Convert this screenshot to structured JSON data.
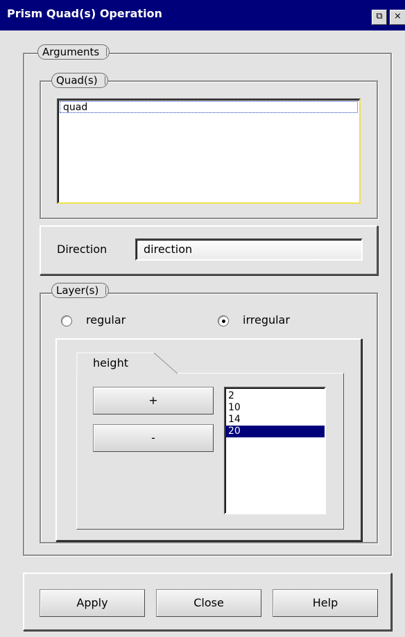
{
  "window": {
    "title": "Prism Quad(s) Operation",
    "restore_icon": "restore-icon",
    "close_icon": "close-icon"
  },
  "arguments": {
    "label": "Arguments",
    "quads": {
      "label": "Quad(s)",
      "items": [
        "quad"
      ]
    },
    "direction": {
      "label": "Direction",
      "value": "direction"
    },
    "layers": {
      "label": "Layer(s)",
      "options": [
        {
          "label": "regular",
          "selected": false
        },
        {
          "label": "irregular",
          "selected": true
        }
      ],
      "tab": {
        "label": "height",
        "add_label": "+",
        "remove_label": "-",
        "values": [
          "2",
          "10",
          "14",
          "20"
        ],
        "selected_value": "20"
      }
    }
  },
  "footer": {
    "apply_label": "Apply",
    "close_label": "Close",
    "help_label": "Help"
  },
  "colors": {
    "titlebar": "#00007b",
    "selection": "#00007b",
    "face": "#e3e3e3"
  }
}
